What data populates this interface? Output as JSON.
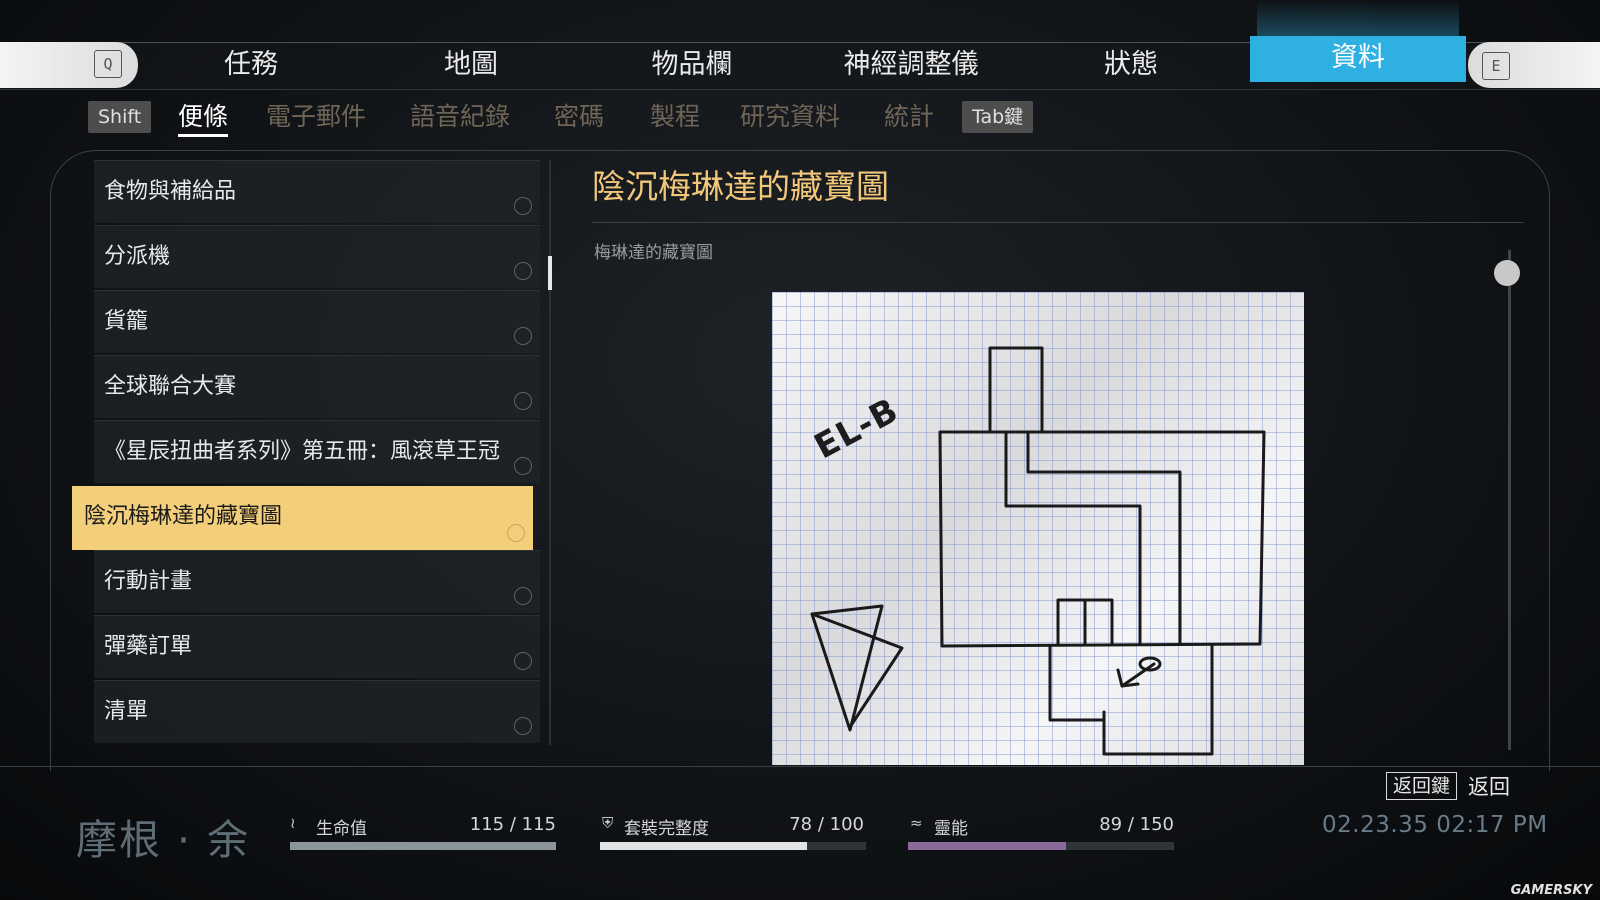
{
  "top_nav": {
    "left_key": "Q",
    "right_key": "E",
    "tabs": [
      {
        "label": "任務"
      },
      {
        "label": "地圖"
      },
      {
        "label": "物品欄"
      },
      {
        "label": "神經調整儀"
      },
      {
        "label": "狀態"
      },
      {
        "label": "資料",
        "active": true
      }
    ]
  },
  "sub_nav": {
    "left_key": "Shift",
    "right_key": "Tab鍵",
    "tabs": [
      {
        "label": "便條",
        "active": true
      },
      {
        "label": "電子郵件"
      },
      {
        "label": "語音紀錄"
      },
      {
        "label": "密碼"
      },
      {
        "label": "製程"
      },
      {
        "label": "研究資料"
      },
      {
        "label": "統計"
      }
    ]
  },
  "note_list": {
    "items": [
      {
        "label": "食物與補給品"
      },
      {
        "label": "分派機"
      },
      {
        "label": "貨籠"
      },
      {
        "label": "全球聯合大賽"
      },
      {
        "label": "《星辰扭曲者系列》第五冊：風滾草王冠"
      },
      {
        "label": "陰沉梅琳達的藏寶圖",
        "selected": true
      },
      {
        "label": "行動計畫"
      },
      {
        "label": "彈藥訂單"
      },
      {
        "label": "清單"
      }
    ]
  },
  "detail": {
    "title": "陰沉梅琳達的藏寶圖",
    "subtitle": "梅琳達的藏寶圖",
    "map_label": "EL-B"
  },
  "back": {
    "key": "返回鍵",
    "label": "返回"
  },
  "player": {
    "name": "摩根 · 余"
  },
  "stats": {
    "health": {
      "label": "生命值",
      "value": "115 / 115",
      "fraction": 1.0,
      "color": "#8a959c",
      "icon": "pulse-icon"
    },
    "suit": {
      "label": "套裝完整度",
      "value": "78 / 100",
      "fraction": 0.78,
      "color": "#e2e2e2",
      "icon": "shield-icon"
    },
    "psi": {
      "label": "靈能",
      "value": "89 / 150",
      "fraction": 0.593,
      "color": "#8a6a9a",
      "icon": "psi-icon"
    }
  },
  "datetime": "02.23.35 02:17 PM",
  "watermark": "GAMERSKY",
  "colors": {
    "accent_blue": "#2eb0e3",
    "selected_gold": "#f4cf7b",
    "title_gold": "#f2c77a"
  }
}
